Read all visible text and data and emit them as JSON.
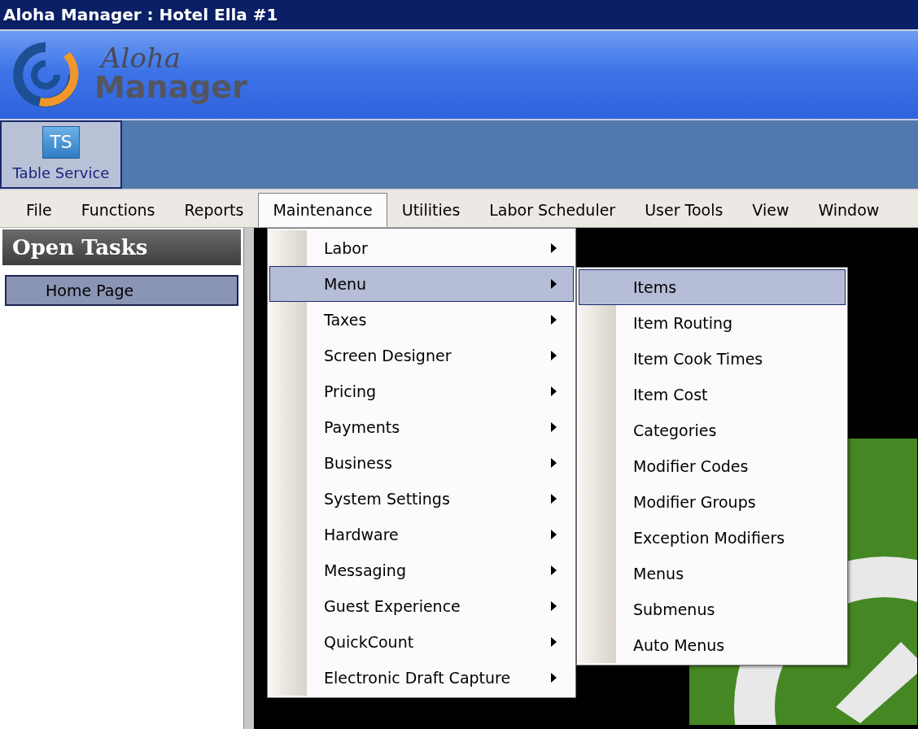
{
  "window": {
    "title": "Aloha Manager : Hotel Ella #1"
  },
  "logo": {
    "script": "Aloha",
    "wordmark": "Manager"
  },
  "toolbar": {
    "buttons": [
      {
        "icon_text": "TS",
        "label": "Table Service",
        "selected": true
      }
    ]
  },
  "menu_bar": [
    {
      "label": "File",
      "selected": false
    },
    {
      "label": "Functions",
      "selected": false
    },
    {
      "label": "Reports",
      "selected": false
    },
    {
      "label": "Maintenance",
      "selected": true
    },
    {
      "label": "Utilities",
      "selected": false
    },
    {
      "label": "Labor Scheduler",
      "selected": false
    },
    {
      "label": "User Tools",
      "selected": false
    },
    {
      "label": "View",
      "selected": false
    },
    {
      "label": "Window",
      "selected": false
    }
  ],
  "open_tasks": {
    "title": "Open Tasks",
    "items": [
      {
        "label": "Home Page",
        "selected": true
      }
    ]
  },
  "dropdown": {
    "items": [
      {
        "label": "Labor",
        "selected": false
      },
      {
        "label": "Menu",
        "selected": true
      },
      {
        "label": "Taxes",
        "selected": false
      },
      {
        "label": "Screen Designer",
        "selected": false
      },
      {
        "label": "Pricing",
        "selected": false
      },
      {
        "label": "Payments",
        "selected": false
      },
      {
        "label": "Business",
        "selected": false
      },
      {
        "label": "System Settings",
        "selected": false
      },
      {
        "label": "Hardware",
        "selected": false
      },
      {
        "label": "Messaging",
        "selected": false
      },
      {
        "label": "Guest Experience",
        "selected": false
      },
      {
        "label": "QuickCount",
        "selected": false
      },
      {
        "label": "Electronic Draft Capture",
        "selected": false
      }
    ]
  },
  "submenu": {
    "items": [
      {
        "label": "Items",
        "selected": true
      },
      {
        "label": "Item Routing",
        "selected": false
      },
      {
        "label": "Item Cook Times",
        "selected": false
      },
      {
        "label": "Item Cost",
        "selected": false
      },
      {
        "label": "Categories",
        "selected": false
      },
      {
        "label": "Modifier Codes",
        "selected": false
      },
      {
        "label": "Modifier Groups",
        "selected": false
      },
      {
        "label": "Exception Modifiers",
        "selected": false
      },
      {
        "label": "Menus",
        "selected": false
      },
      {
        "label": "Submenus",
        "selected": false
      },
      {
        "label": "Auto Menus",
        "selected": false
      }
    ]
  }
}
